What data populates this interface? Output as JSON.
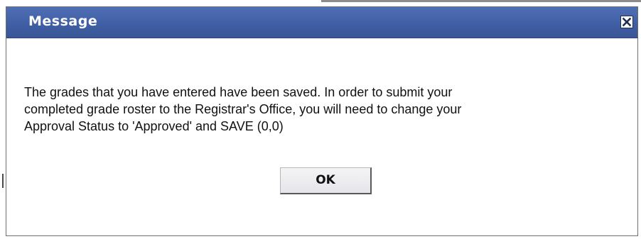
{
  "dialog": {
    "title": "Message",
    "close_icon": "close-icon",
    "message": "The grades that you have entered have been saved.  In order to submit your\ncompleted grade roster to the Registrar's Office, you will need to change your\nApproval Status to 'Approved' and SAVE (0,0)",
    "ok_label": "OK"
  },
  "colors": {
    "titlebar": "#3f5da2",
    "title_text": "#ffffff",
    "button_face": "#eaeaee"
  }
}
